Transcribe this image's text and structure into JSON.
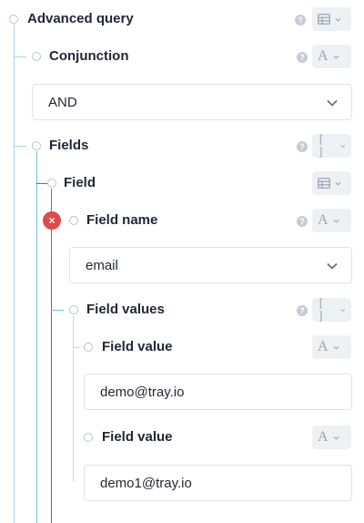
{
  "nodes": {
    "advanced_query": {
      "label": "Advanced query",
      "type_icon": "table-icon"
    },
    "conjunction": {
      "label": "Conjunction",
      "type_icon": "text-type-icon",
      "type_glyph": "A",
      "selected": "AND"
    },
    "fields": {
      "label": "Fields",
      "type_icon": "array-icon",
      "type_glyph": "[ ]"
    },
    "field": {
      "label": "Field",
      "type_icon": "table-icon"
    },
    "field_name": {
      "label": "Field name",
      "type_icon": "text-type-icon",
      "type_glyph": "A",
      "selected": "email",
      "error_glyph": "×"
    },
    "field_values": {
      "label": "Field values",
      "type_icon": "array-icon",
      "type_glyph": "[ ]"
    },
    "field_value_1": {
      "label": "Field value",
      "type_icon": "text-type-icon",
      "type_glyph": "A",
      "value": "demo@tray.io"
    },
    "field_value_2": {
      "label": "Field value",
      "type_icon": "text-type-icon",
      "type_glyph": "A",
      "value": "demo1@tray.io"
    }
  },
  "help_glyph": "?",
  "colors": {
    "tree_line": "#6bc4de",
    "field_line": "#4a6cd0",
    "error": "#e04a4a",
    "error_line": "#d94a4a"
  }
}
